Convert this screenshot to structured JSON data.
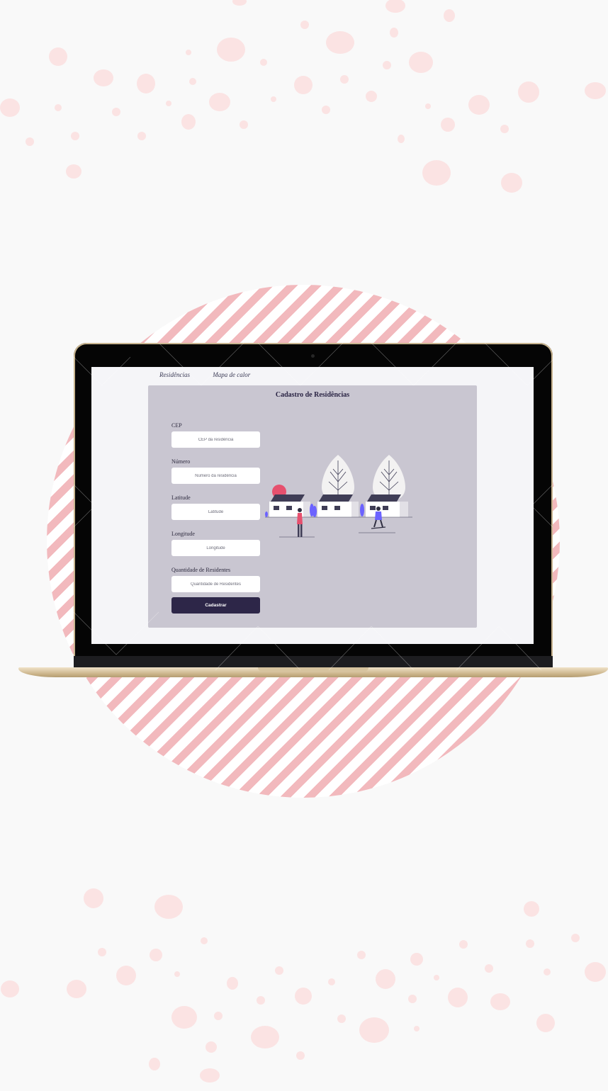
{
  "nav": {
    "items": [
      "Residências",
      "Mapa de calor"
    ]
  },
  "card": {
    "title": "Cadastro de Residências"
  },
  "form": {
    "fields": [
      {
        "label": "CEP",
        "placeholder": "CEP da residência"
      },
      {
        "label": "Número",
        "placeholder": "Número da residência"
      },
      {
        "label": "Latitude",
        "placeholder": "Latitude"
      },
      {
        "label": "Longitude",
        "placeholder": "Longitude"
      },
      {
        "label": "Quantidade de Residentes",
        "placeholder": "Quantidade de Residentes"
      }
    ],
    "submit_label": "Cadastrar"
  },
  "colors": {
    "page_background": "#f9f9f9",
    "stripe_pink": "#f2b9bd",
    "dot_pink": "#fbe3e3",
    "card_background": "#c9c6d1",
    "button_background": "#2d2648",
    "accent_purple": "#6c63ff",
    "sun_pink": "#e6506e"
  }
}
